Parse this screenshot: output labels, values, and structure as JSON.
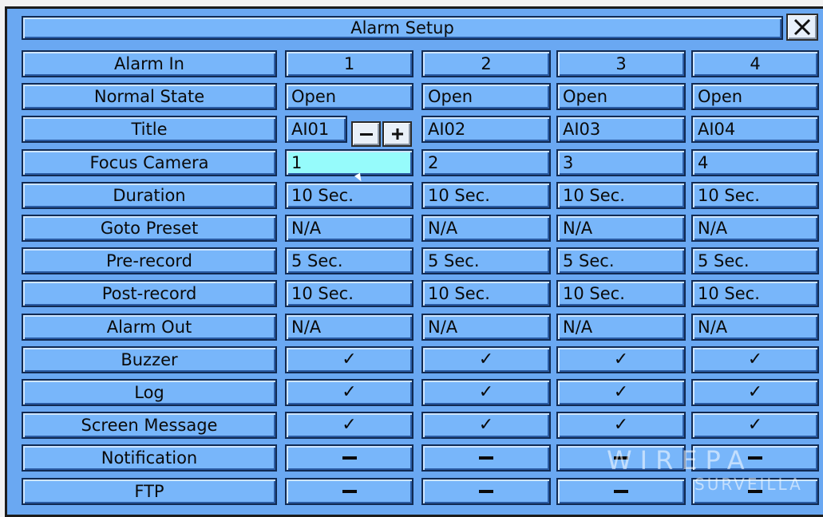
{
  "dialog": {
    "title": "Alarm Setup",
    "close_icon": "close-icon"
  },
  "header_row": {
    "label": "Alarm In",
    "columns": [
      "1",
      "2",
      "3",
      "4"
    ]
  },
  "rows": [
    {
      "label": "Normal State",
      "values": [
        "Open",
        "Open",
        "Open",
        "Open"
      ],
      "type": "text"
    },
    {
      "label": "Title",
      "values": [
        "AI01",
        "AI02",
        "AI03",
        "AI04"
      ],
      "type": "text"
    },
    {
      "label": "Focus Camera",
      "values": [
        "1",
        "2",
        "3",
        "4"
      ],
      "type": "text"
    },
    {
      "label": "Duration",
      "values": [
        "10 Sec.",
        "10 Sec.",
        "10 Sec.",
        "10 Sec."
      ],
      "type": "text"
    },
    {
      "label": "Goto Preset",
      "values": [
        "N/A",
        "N/A",
        "N/A",
        "N/A"
      ],
      "type": "text"
    },
    {
      "label": "Pre-record",
      "values": [
        "5 Sec.",
        "5 Sec.",
        "5 Sec.",
        "5 Sec."
      ],
      "type": "text"
    },
    {
      "label": "Post-record",
      "values": [
        "10 Sec.",
        "10 Sec.",
        "10 Sec.",
        "10 Sec."
      ],
      "type": "text"
    },
    {
      "label": "Alarm Out",
      "values": [
        "N/A",
        "N/A",
        "N/A",
        "N/A"
      ],
      "type": "text"
    },
    {
      "label": "Buzzer",
      "values": [
        "✓",
        "✓",
        "✓",
        "✓"
      ],
      "type": "check"
    },
    {
      "label": "Log",
      "values": [
        "✓",
        "✓",
        "✓",
        "✓"
      ],
      "type": "check"
    },
    {
      "label": "Screen Message",
      "values": [
        "✓",
        "✓",
        "✓",
        "✓"
      ],
      "type": "check"
    },
    {
      "label": "Notification",
      "values": [
        "–",
        "–",
        "–",
        "–"
      ],
      "type": "dash"
    },
    {
      "label": "FTP",
      "values": [
        "–",
        "–",
        "–",
        "–"
      ],
      "type": "dash"
    }
  ],
  "title_stepper": {
    "minus_label": "−",
    "plus_label": "+"
  },
  "selected_cell": {
    "row": "Focus Camera",
    "column": "1"
  },
  "watermark": {
    "line1": "WIREPA",
    "line2": "SURVEILLA"
  },
  "colors": {
    "panel_bg": "#6aa8f2",
    "cell_bg": "#78b6fa",
    "selected_bg": "#96fbfb",
    "border": "#112a52"
  }
}
